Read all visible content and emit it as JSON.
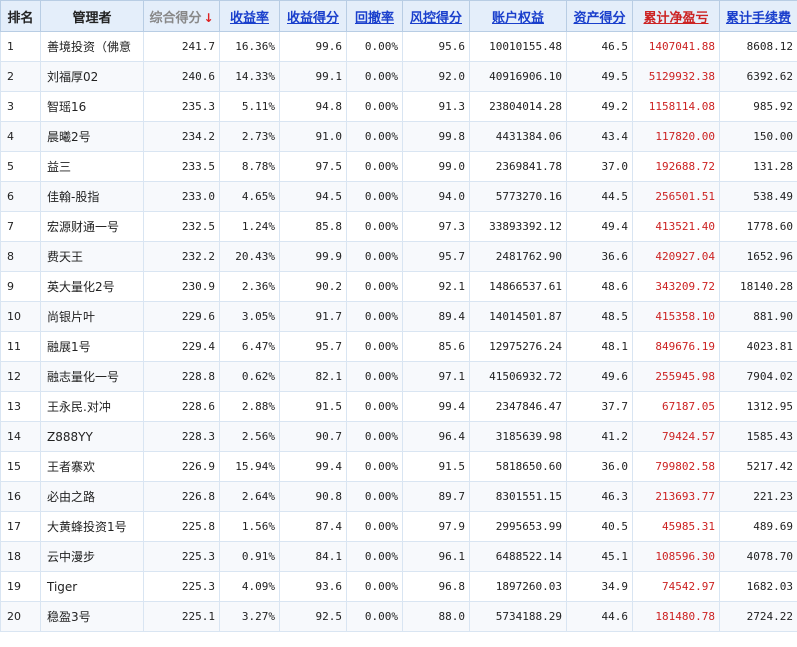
{
  "headers": {
    "rank": "排名",
    "manager": "管理者",
    "total_score": "综合得分",
    "total_score_arrow": "↓",
    "return_rate": "收益率",
    "return_score": "收益得分",
    "drawdown": "回撤率",
    "risk_score": "风控得分",
    "equity": "账户权益",
    "asset_score": "资产得分",
    "net_profit": "累计净盈亏",
    "fees": "累计手续费"
  },
  "colors": {
    "header_bg": "#e4eefa",
    "link_blue": "#1a3fcc",
    "profit_red": "#cc2222"
  },
  "rows": [
    {
      "rank": "1",
      "manager": "善境投资（佛意",
      "total": "241.7",
      "ret": "16.36%",
      "ret_score": "99.6",
      "dd": "0.00%",
      "risk": "95.6",
      "equity": "10010155.48",
      "asset": "46.5",
      "profit": "1407041.88",
      "fees": "8608.12"
    },
    {
      "rank": "2",
      "manager": "刘福厚02",
      "total": "240.6",
      "ret": "14.33%",
      "ret_score": "99.1",
      "dd": "0.00%",
      "risk": "92.0",
      "equity": "40916906.10",
      "asset": "49.5",
      "profit": "5129932.38",
      "fees": "6392.62"
    },
    {
      "rank": "3",
      "manager": "智瑶16",
      "total": "235.3",
      "ret": "5.11%",
      "ret_score": "94.8",
      "dd": "0.00%",
      "risk": "91.3",
      "equity": "23804014.28",
      "asset": "49.2",
      "profit": "1158114.08",
      "fees": "985.92"
    },
    {
      "rank": "4",
      "manager": "晨曦2号",
      "total": "234.2",
      "ret": "2.73%",
      "ret_score": "91.0",
      "dd": "0.00%",
      "risk": "99.8",
      "equity": "4431384.06",
      "asset": "43.4",
      "profit": "117820.00",
      "fees": "150.00"
    },
    {
      "rank": "5",
      "manager": "益三",
      "total": "233.5",
      "ret": "8.78%",
      "ret_score": "97.5",
      "dd": "0.00%",
      "risk": "99.0",
      "equity": "2369841.78",
      "asset": "37.0",
      "profit": "192688.72",
      "fees": "131.28"
    },
    {
      "rank": "6",
      "manager": "佳翰-股指",
      "total": "233.0",
      "ret": "4.65%",
      "ret_score": "94.5",
      "dd": "0.00%",
      "risk": "94.0",
      "equity": "5773270.16",
      "asset": "44.5",
      "profit": "256501.51",
      "fees": "538.49"
    },
    {
      "rank": "7",
      "manager": "宏源财通一号",
      "total": "232.5",
      "ret": "1.24%",
      "ret_score": "85.8",
      "dd": "0.00%",
      "risk": "97.3",
      "equity": "33893392.12",
      "asset": "49.4",
      "profit": "413521.40",
      "fees": "1778.60"
    },
    {
      "rank": "8",
      "manager": "费天王",
      "total": "232.2",
      "ret": "20.43%",
      "ret_score": "99.9",
      "dd": "0.00%",
      "risk": "95.7",
      "equity": "2481762.90",
      "asset": "36.6",
      "profit": "420927.04",
      "fees": "1652.96"
    },
    {
      "rank": "9",
      "manager": "英大量化2号",
      "total": "230.9",
      "ret": "2.36%",
      "ret_score": "90.2",
      "dd": "0.00%",
      "risk": "92.1",
      "equity": "14866537.61",
      "asset": "48.6",
      "profit": "343209.72",
      "fees": "18140.28"
    },
    {
      "rank": "10",
      "manager": "尚银片叶",
      "total": "229.6",
      "ret": "3.05%",
      "ret_score": "91.7",
      "dd": "0.00%",
      "risk": "89.4",
      "equity": "14014501.87",
      "asset": "48.5",
      "profit": "415358.10",
      "fees": "881.90"
    },
    {
      "rank": "11",
      "manager": "融展1号",
      "total": "229.4",
      "ret": "6.47%",
      "ret_score": "95.7",
      "dd": "0.00%",
      "risk": "85.6",
      "equity": "12975276.24",
      "asset": "48.1",
      "profit": "849676.19",
      "fees": "4023.81"
    },
    {
      "rank": "12",
      "manager": "融志量化一号",
      "total": "228.8",
      "ret": "0.62%",
      "ret_score": "82.1",
      "dd": "0.00%",
      "risk": "97.1",
      "equity": "41506932.72",
      "asset": "49.6",
      "profit": "255945.98",
      "fees": "7904.02"
    },
    {
      "rank": "13",
      "manager": "王永民.对冲",
      "total": "228.6",
      "ret": "2.88%",
      "ret_score": "91.5",
      "dd": "0.00%",
      "risk": "99.4",
      "equity": "2347846.47",
      "asset": "37.7",
      "profit": "67187.05",
      "fees": "1312.95"
    },
    {
      "rank": "14",
      "manager": "Z888YY",
      "total": "228.3",
      "ret": "2.56%",
      "ret_score": "90.7",
      "dd": "0.00%",
      "risk": "96.4",
      "equity": "3185639.98",
      "asset": "41.2",
      "profit": "79424.57",
      "fees": "1585.43"
    },
    {
      "rank": "15",
      "manager": "王者寨欢",
      "total": "226.9",
      "ret": "15.94%",
      "ret_score": "99.4",
      "dd": "0.00%",
      "risk": "91.5",
      "equity": "5818650.60",
      "asset": "36.0",
      "profit": "799802.58",
      "fees": "5217.42"
    },
    {
      "rank": "16",
      "manager": "必由之路",
      "total": "226.8",
      "ret": "2.64%",
      "ret_score": "90.8",
      "dd": "0.00%",
      "risk": "89.7",
      "equity": "8301551.15",
      "asset": "46.3",
      "profit": "213693.77",
      "fees": "221.23"
    },
    {
      "rank": "17",
      "manager": "大黄蜂投资1号",
      "total": "225.8",
      "ret": "1.56%",
      "ret_score": "87.4",
      "dd": "0.00%",
      "risk": "97.9",
      "equity": "2995653.99",
      "asset": "40.5",
      "profit": "45985.31",
      "fees": "489.69"
    },
    {
      "rank": "18",
      "manager": "云中漫步",
      "total": "225.3",
      "ret": "0.91%",
      "ret_score": "84.1",
      "dd": "0.00%",
      "risk": "96.1",
      "equity": "6488522.14",
      "asset": "45.1",
      "profit": "108596.30",
      "fees": "4078.70"
    },
    {
      "rank": "19",
      "manager": "Tiger",
      "total": "225.3",
      "ret": "4.09%",
      "ret_score": "93.6",
      "dd": "0.00%",
      "risk": "96.8",
      "equity": "1897260.03",
      "asset": "34.9",
      "profit": "74542.97",
      "fees": "1682.03"
    },
    {
      "rank": "20",
      "manager": "稳盈3号",
      "total": "225.1",
      "ret": "3.27%",
      "ret_score": "92.5",
      "dd": "0.00%",
      "risk": "88.0",
      "equity": "5734188.29",
      "asset": "44.6",
      "profit": "181480.78",
      "fees": "2724.22"
    }
  ]
}
